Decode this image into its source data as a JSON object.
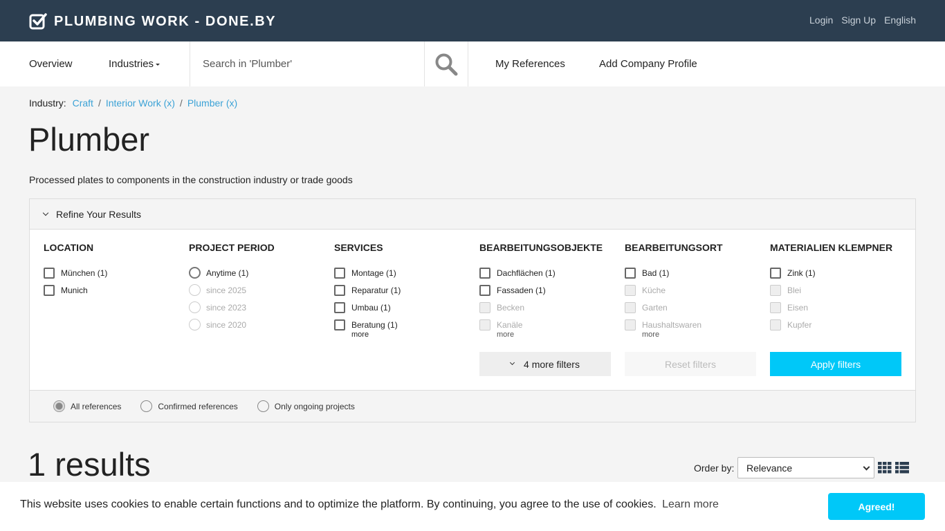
{
  "header": {
    "brand": "PLUMBING WORK - DONE.BY",
    "links": [
      "Login",
      "Sign Up",
      "English"
    ]
  },
  "nav": {
    "overview": "Overview",
    "industries": "Industries",
    "search_placeholder": "Search in 'Plumber'",
    "my_references": "My References",
    "add_company": "Add Company Profile"
  },
  "breadcrumb": {
    "label": "Industry:",
    "items": [
      "Craft",
      "Interior Work (x)",
      "Plumber (x)"
    ]
  },
  "page": {
    "title": "Plumber",
    "description": "Processed plates to components in the construction industry or trade goods"
  },
  "refine": {
    "title": "Refine Your Results",
    "columns": [
      {
        "title": "LOCATION",
        "options": [
          "München (1)",
          "Munich"
        ]
      },
      {
        "title": "PROJECT PERIOD",
        "options": [
          "Anytime (1)",
          "since 2025",
          "since 2023",
          "since 2020"
        ]
      },
      {
        "title": "SERVICES",
        "options": [
          "Montage (1)",
          "Reparatur (1)",
          "Umbau (1)",
          "Beratung (1)"
        ],
        "more": "more"
      },
      {
        "title": "BEARBEITUNGSOBJEKTE",
        "options": [
          "Dachflächen (1)",
          "Fassaden (1)",
          "Becken",
          "Kanäle"
        ],
        "more": "more"
      },
      {
        "title": "BEARBEITUNGSORT",
        "options": [
          "Bad (1)",
          "Küche",
          "Garten",
          "Haushaltswaren"
        ],
        "more": "more"
      },
      {
        "title": "MATERIALIEN KLEMPNER",
        "options": [
          "Zink (1)",
          "Blei",
          "Eisen",
          "Kupfer"
        ]
      }
    ],
    "more_filters": "4 more filters",
    "reset": "Reset filters",
    "apply": "Apply filters",
    "reference_options": [
      "All references",
      "Confirmed references",
      "Only ongoing projects"
    ],
    "selected_reference": "All references"
  },
  "results": {
    "count_text": "1 results",
    "order_label": "Order by:",
    "order_value": "Relevance"
  },
  "cookie": {
    "text": "This website uses cookies to enable certain functions and to optimize the platform. By continuing, you agree to the use of cookies.",
    "link": "Learn more",
    "button": "Agreed!"
  },
  "colors": {
    "header_bg": "#2c3e50",
    "accent": "#00c8f8",
    "link": "#3ba2d6"
  },
  "icons": [
    "check-square-icon",
    "search-icon",
    "chevron-down-icon",
    "grid-view-icon",
    "list-view-icon"
  ]
}
